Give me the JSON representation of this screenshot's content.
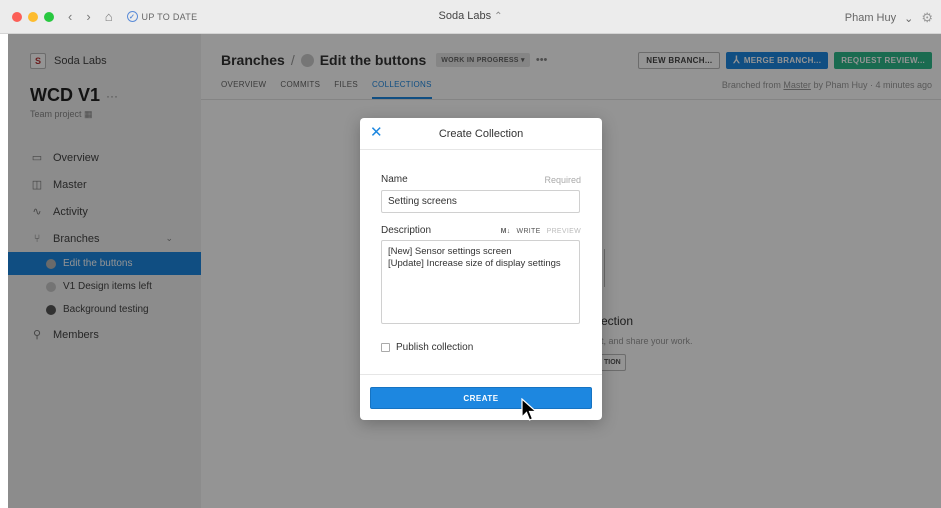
{
  "titlebar": {
    "nav_back": "‹",
    "nav_forward": "›",
    "home_icon": "⌂",
    "status": "UP TO DATE",
    "app_title": "Soda Labs",
    "app_title_chevron": "⌃",
    "user_name": "Pham Huy",
    "user_chevron": "⌄"
  },
  "sidebar": {
    "org_name": "Soda Labs",
    "org_logo_letter": "S",
    "project_title": "WCD V1",
    "project_more": "···",
    "project_sub": "Team project",
    "items": [
      {
        "label": "Overview",
        "icon": "overview-icon",
        "glyph": "▭"
      },
      {
        "label": "Master",
        "icon": "master-icon",
        "glyph": "◫"
      },
      {
        "label": "Activity",
        "icon": "activity-icon",
        "glyph": "∿"
      },
      {
        "label": "Branches",
        "icon": "branches-icon",
        "glyph": "⑂"
      },
      {
        "label": "Members",
        "icon": "members-icon",
        "glyph": "⚲"
      }
    ],
    "branches": [
      {
        "label": "Edit the buttons"
      },
      {
        "label": "V1 Design items left"
      },
      {
        "label": "Background testing"
      }
    ]
  },
  "header": {
    "breadcrumb_root": "Branches",
    "breadcrumb_sep": "/",
    "branch_name": "Edit the buttons",
    "status_badge": "WORK IN PROGRESS ▾",
    "more": "•••",
    "tabs": [
      {
        "label": "OVERVIEW"
      },
      {
        "label": "COMMITS"
      },
      {
        "label": "FILES"
      },
      {
        "label": "COLLECTIONS"
      }
    ],
    "new_branch_label": "NEW BRANCH...",
    "merge_branch_label": "MERGE BRANCH...",
    "request_review_label": "REQUEST REVIEW...",
    "branched_prefix": "Branched from",
    "branched_link": "Master",
    "branched_suffix": "by Pham Huy · 4 minutes ago"
  },
  "empty_state": {
    "title": "ection",
    "subtitle": "t, and share your work.",
    "button": "TION"
  },
  "modal": {
    "close": "✕",
    "title": "Create Collection",
    "name_label": "Name",
    "name_hint": "Required",
    "name_value": "Setting screens",
    "description_label": "Description",
    "md_label": "M↓",
    "write_label": "WRITE",
    "preview_label": "PREVIEW",
    "description_lines": [
      "[New] Sensor settings screen",
      "[Update] Increase size of display settings"
    ],
    "publish_label": "Publish collection",
    "create_label": "CREATE"
  },
  "colors": {
    "accent": "#1d87e0",
    "green": "#2db88a"
  }
}
